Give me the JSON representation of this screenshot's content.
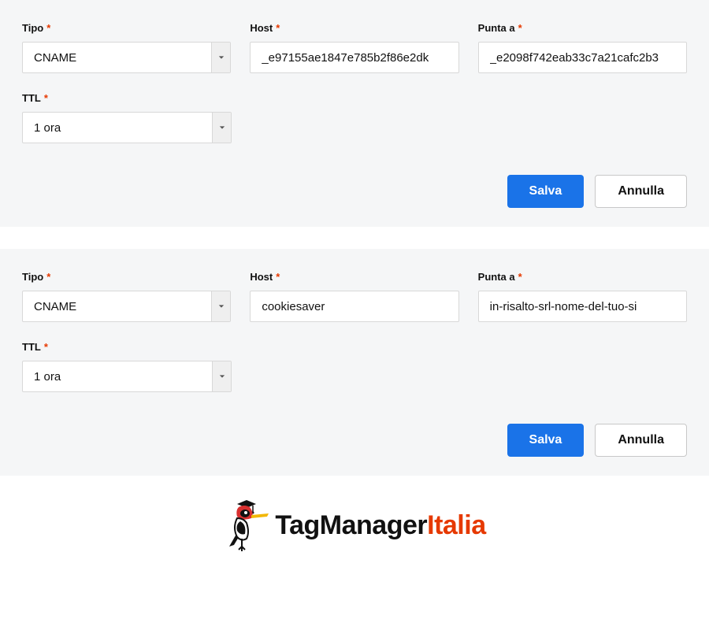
{
  "labels": {
    "tipo": "Tipo",
    "host": "Host",
    "punta_a": "Punta a",
    "ttl": "TTL",
    "required": "*"
  },
  "buttons": {
    "save": "Salva",
    "cancel": "Annulla"
  },
  "forms": [
    {
      "tipo": "CNAME",
      "host": "_e97155ae1847e785b2f86e2dk",
      "punta_a": "_e2098f742eab33c7a21cafc2b3",
      "ttl": "1 ora"
    },
    {
      "tipo": "CNAME",
      "host": "cookiesaver",
      "punta_a": "in-risalto-srl-nome-del-tuo-si",
      "ttl": "1 ora"
    }
  ],
  "logo": {
    "prefix": "TagManager",
    "accent": "Italia"
  }
}
